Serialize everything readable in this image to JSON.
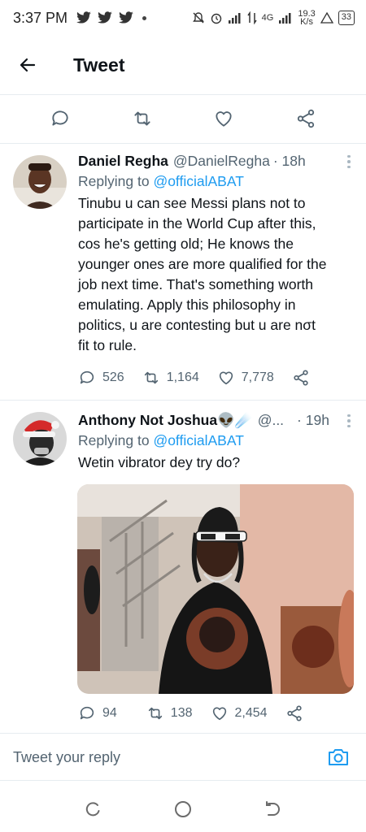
{
  "status_bar": {
    "time": "3:37 PM",
    "network_label": "4G",
    "speed_value": "19.3",
    "speed_unit": "K/s",
    "battery": "33"
  },
  "nav": {
    "title": "Tweet"
  },
  "tweets": [
    {
      "name": "Daniel Regha",
      "handle": "@DanielRegha",
      "time": "· 18h",
      "replying_prefix": "Replying to",
      "replying_to": "@officialABAT",
      "text": "Tinubu u can see Messi plans not to\nparticipate in the World Cup after this,\ncos he's getting old; He knows the\nyounger ones are more qualified for the\njob next time. That's something worth\nemulating. Apply this philosophy in\npolitics, u are contesting but u are nσt\nfit to rule.",
      "replies": "526",
      "retweets": "1,164",
      "likes": "7,778"
    },
    {
      "name": "Anthony Not Joshua👽☄️",
      "handle": "@...",
      "time": "· 19h",
      "replying_prefix": "Replying to",
      "replying_to": "@officialABAT",
      "text": "Wetin vibrator dey try do?",
      "replies": "94",
      "retweets": "138",
      "likes": "2,454"
    }
  ],
  "reply_bar": {
    "placeholder": "Tweet your reply"
  },
  "colors": {
    "accent": "#1d9bf0",
    "secondary_text": "#536471",
    "divider": "#e6ecf0"
  }
}
